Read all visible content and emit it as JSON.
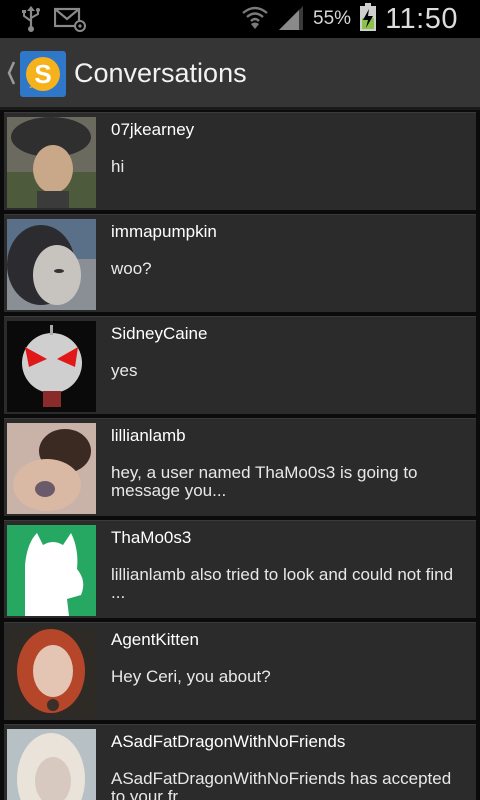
{
  "status_bar": {
    "icons": [
      "usb-icon",
      "email-icon",
      "wifi-icon",
      "signal-icon",
      "battery-charging-icon"
    ],
    "battery_percent": "55%",
    "time": "11:50"
  },
  "action_bar": {
    "title": "Conversations",
    "app_icon_letter": "S",
    "colors": {
      "app_icon_bg": "#2f77c8",
      "app_icon_circle": "#f6b21b"
    }
  },
  "conversations": [
    {
      "name": "07jkearney",
      "message": "hi"
    },
    {
      "name": "immapumpkin",
      "message": "woo?"
    },
    {
      "name": "SidneyCaine",
      "message": "yes"
    },
    {
      "name": "lillianlamb",
      "message": "hey, a user named ThaMo0s3 is going to message you..."
    },
    {
      "name": "ThaMo0s3",
      "message": "lillianlamb also tried to look and could not find ..."
    },
    {
      "name": "AgentKitten",
      "message": "Hey Ceri, you about?"
    },
    {
      "name": "ASadFatDragonWithNoFriends",
      "message": "ASadFatDragonWithNoFriends has accepted to your fr..."
    }
  ]
}
